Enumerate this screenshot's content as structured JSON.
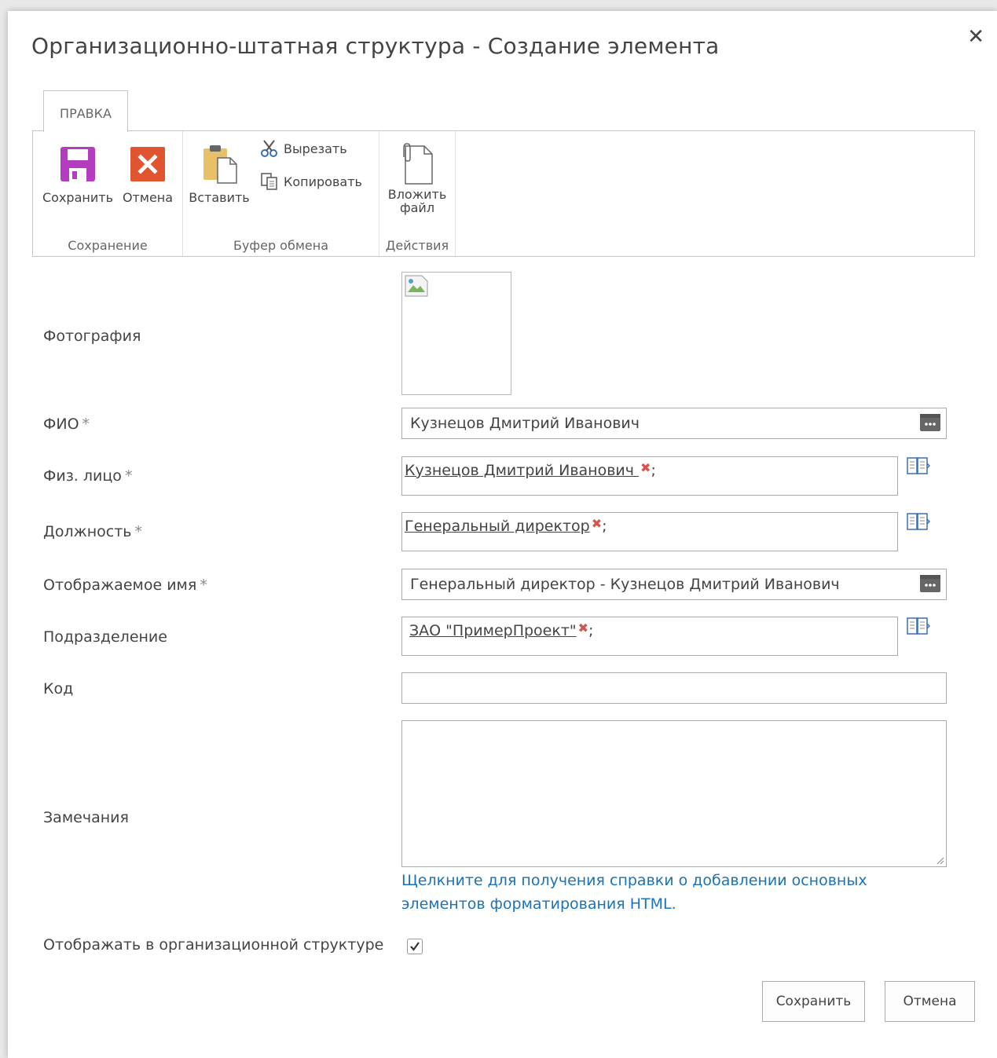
{
  "dialog": {
    "title": "Организационно-штатная структура - Создание элемента",
    "close_glyph": "✕"
  },
  "ribbon": {
    "tab_label": "ПРАВКА",
    "groups": {
      "save": {
        "label": "Сохранение",
        "save_label": "Сохранить",
        "cancel_label": "Отмена"
      },
      "clipboard": {
        "label": "Буфер обмена",
        "paste_label": "Вставить",
        "cut_label": "Вырезать",
        "copy_label": "Копировать"
      },
      "actions": {
        "label": "Действия",
        "attach_line1": "Вложить",
        "attach_line2": "файл"
      }
    }
  },
  "form": {
    "photo": {
      "label": "Фотография"
    },
    "fio": {
      "label": "ФИО",
      "required": "*",
      "value": "Кузнецов Дмитрий Иванович"
    },
    "person": {
      "label": "Физ. лицо",
      "required": "*",
      "value": "Кузнецов Дмитрий Иванович ",
      "remove": "✖",
      "sep": ";"
    },
    "position": {
      "label": "Должность",
      "required": "*",
      "value": "Генеральный директор",
      "remove": "✖",
      "sep": ";"
    },
    "display_name": {
      "label": "Отображаемое имя",
      "required": "*",
      "value": "Генеральный директор - Кузнецов Дмитрий Иванович"
    },
    "department": {
      "label": "Подразделение",
      "value": "ЗАО \"ПримерПроект\"",
      "remove": "✖",
      "sep": ";"
    },
    "code": {
      "label": "Код",
      "value": ""
    },
    "notes": {
      "label": "Замечания",
      "value": "",
      "help_line1": "Щелкните для получения справки о добавлении основных",
      "help_line2": "элементов форматирования HTML."
    },
    "show_in_org": {
      "label": "Отображать в организационной структуре",
      "checked": true
    }
  },
  "footer": {
    "save_label": "Сохранить",
    "cancel_label": "Отмена"
  },
  "colors": {
    "save_icon": "#b43dbf",
    "cancel_icon": "#e0552f",
    "paste_icon": "#e8c068",
    "link": "#1a73b8",
    "remove_x": "#d9534f"
  }
}
